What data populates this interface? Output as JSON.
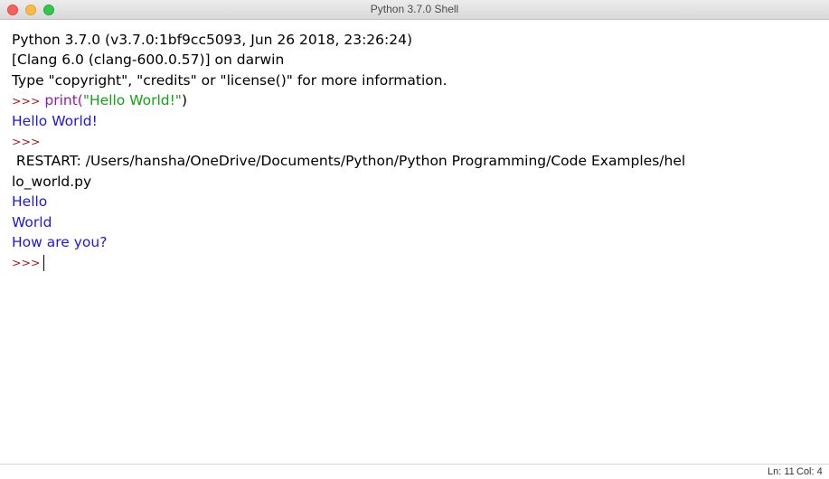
{
  "window": {
    "title": "Python 3.7.0 Shell"
  },
  "shell": {
    "banner": [
      "Python 3.7.0 (v3.7.0:1bf9cc5093, Jun 26 2018, 23:26:24)",
      "[Clang 6.0 (clang-600.0.57)] on darwin",
      "Type \"copyright\", \"credits\" or \"license()\" for more information."
    ],
    "prompt": ">>>",
    "command": {
      "func": "print(",
      "arg": "\"Hello World!\"",
      "close": ")"
    },
    "output_1": "Hello World!",
    "restart_line_1": " RESTART: /Users/hansha/OneDrive/Documents/Python/Python Programming/Code Examples/hel",
    "restart_line_2": "lo_world.py",
    "output_2": [
      "Hello",
      "World",
      "How are you?"
    ]
  },
  "status": {
    "line": "Ln: 11",
    "col": "Col: 4"
  },
  "colors": {
    "prompt": "#a31515",
    "builtin": "#8e1ab0",
    "string": "#16a116",
    "stdout": "#1e16e6"
  }
}
